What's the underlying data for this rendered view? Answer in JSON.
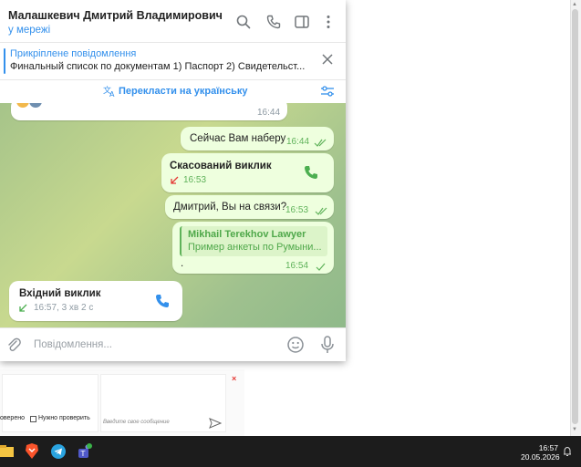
{
  "chat": {
    "contact_name": "Малашкевич Дмитрий Владимирович",
    "status": "у мережі",
    "pinned": {
      "title": "Прикріплене повідомлення",
      "text": "Финальный список по документам  1) Паспорт 2) Свидетельст..."
    },
    "translate_label": "Перекласти на українську",
    "messages": [
      {
        "id": "m0",
        "time": "16:44"
      },
      {
        "id": "m1",
        "text": "Сейчас Вам наберу",
        "time": "16:44"
      },
      {
        "id": "m2",
        "title": "Скасований виклик",
        "time": "16:53"
      },
      {
        "id": "m3",
        "text": "Дмитрий, Вы на связи?",
        "time": "16:53"
      },
      {
        "id": "m4",
        "reply_author": "Mikhail Terekhov Lawyer",
        "reply_text": "Пример анкеты по Румыни...",
        "text": ".",
        "time": "16:54"
      },
      {
        "id": "m5",
        "title": "Вхідний виклик",
        "meta": "16:57, 3 хв 2 с"
      }
    ],
    "composer_placeholder": "Повідомлення..."
  },
  "background_widget": {
    "check1_text": "оверено",
    "check2_text": "Нужно проверить",
    "input_placeholder": "Введите свое сообщение",
    "close_label": "×"
  },
  "taskbar": {
    "time": "16:57",
    "date": "20.05.2026"
  },
  "colors": {
    "accent": "#3390ec",
    "out_bubble": "#eeffde",
    "call_green": "#4caf50",
    "missed_red": "#e53935"
  }
}
